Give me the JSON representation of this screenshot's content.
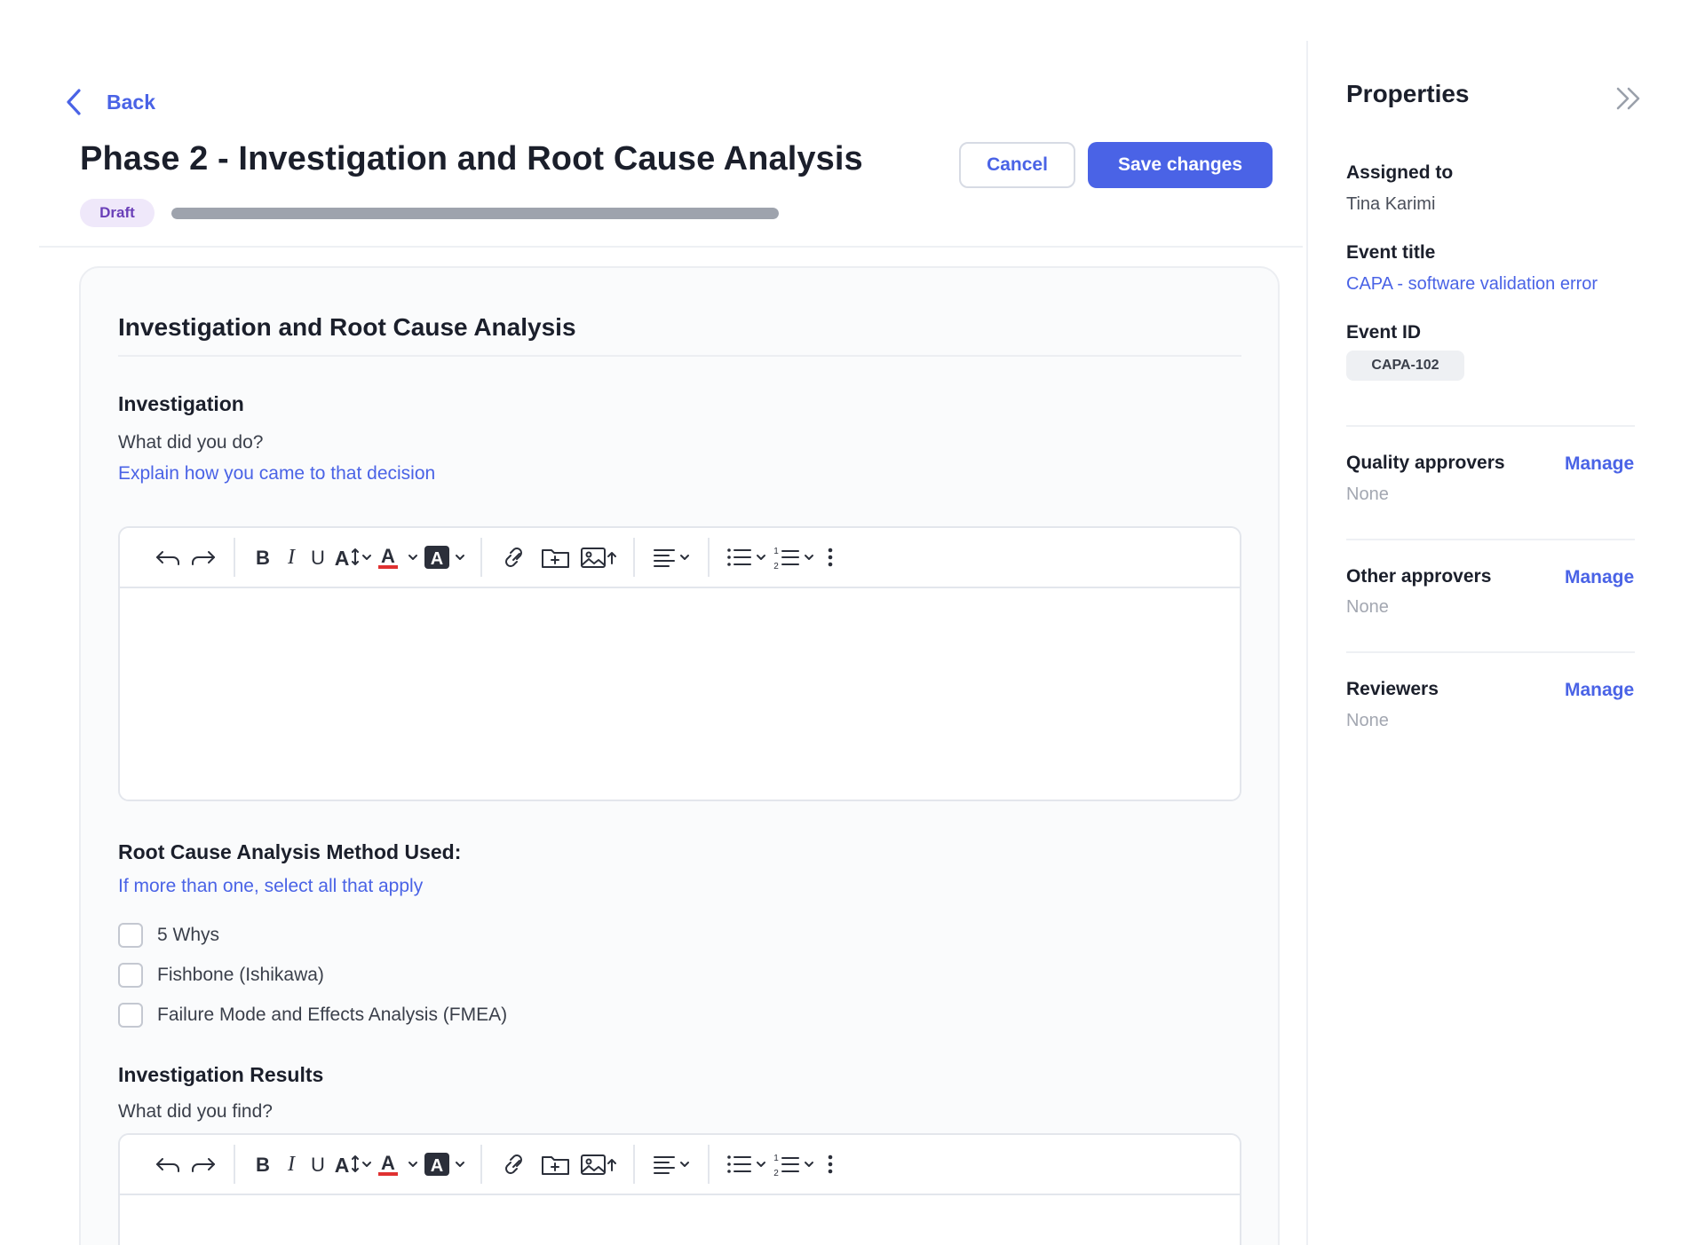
{
  "header": {
    "back_label": "Back",
    "title": "Phase 2 - Investigation and Root Cause Analysis",
    "cancel_label": "Cancel",
    "save_label": "Save changes",
    "status_badge": "Draft",
    "progress_fraction": 1.0
  },
  "card": {
    "title": "Investigation and Root Cause Analysis",
    "investigation": {
      "heading": "Investigation",
      "question": "What did you do?",
      "hint": "Explain how you came to that decision"
    },
    "rca": {
      "heading": "Root Cause Analysis Method Used:",
      "hint": "If more than one, select all that apply",
      "options": [
        {
          "label": "5 Whys",
          "checked": false
        },
        {
          "label": "Fishbone (Ishikawa)",
          "checked": false
        },
        {
          "label": "Failure Mode and Effects Analysis (FMEA)",
          "checked": false
        }
      ]
    },
    "results": {
      "heading": "Investigation Results",
      "question": "What did you find?"
    }
  },
  "toolbar_icons": [
    "undo-icon",
    "redo-icon",
    "bold-icon",
    "italic-icon",
    "underline-icon",
    "font-size-icon",
    "text-color-icon",
    "highlight-color-icon",
    "link-icon",
    "insert-file-icon",
    "insert-image-icon",
    "align-icon",
    "bullet-list-icon",
    "numbered-list-icon",
    "more-options-icon"
  ],
  "properties": {
    "title": "Properties",
    "assigned_to_label": "Assigned to",
    "assigned_to_value": "Tina Karimi",
    "event_title_label": "Event title",
    "event_title_value": "CAPA - software validation error",
    "event_id_label": "Event ID",
    "event_id_value": "CAPA-102",
    "quality_approvers_label": "Quality approvers",
    "quality_approvers_value": "None",
    "other_approvers_label": "Other approvers",
    "other_approvers_value": "None",
    "reviewers_label": "Reviewers",
    "reviewers_value": "None",
    "manage_label": "Manage"
  },
  "colors": {
    "accent": "#4a63e6",
    "draft_badge_bg": "#efe8fa",
    "draft_badge_text": "#6a3fb8",
    "text_color_underline": "#e03131"
  }
}
